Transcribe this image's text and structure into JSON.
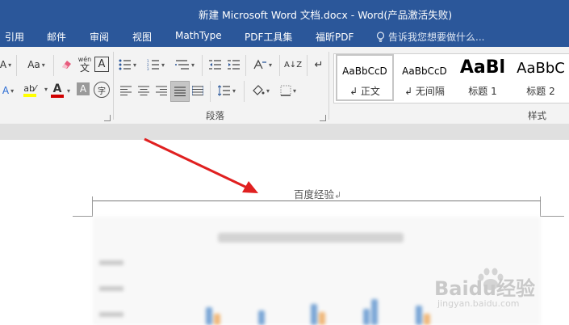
{
  "window": {
    "title": "新建 Microsoft Word 文档.docx - Word(产品激活失败)"
  },
  "menu": {
    "tabs": [
      "引用",
      "邮件",
      "审阅",
      "视图",
      "MathType",
      "PDF工具集",
      "福昕PDF"
    ],
    "tell_me": "告诉我您想要做什么..."
  },
  "ribbon": {
    "font_size_label": "Aa",
    "phonetic_top": "wén",
    "phonetic_char": "文",
    "char_border": "A",
    "font_color": "A",
    "char_shading": "A",
    "enclosed_char": "字",
    "sort_label": "A↓Z",
    "paragraph_group": "段落",
    "styles_group": "样式"
  },
  "styles": [
    {
      "sample": "AaBbCcD",
      "name": "↲ 正文"
    },
    {
      "sample": "AaBbCcD",
      "name": "↲ 无间隔"
    },
    {
      "sample": "AaBl",
      "name": "标题 1"
    },
    {
      "sample": "AaBbC",
      "name": "标题 2"
    }
  ],
  "document": {
    "header_text": "百度经验",
    "paragraph_mark": "↲"
  },
  "watermark": {
    "brand": "Baidu经验",
    "url": "jingyan.baidu.com"
  },
  "colors": {
    "word_blue": "#2b579a",
    "arrow_red": "#e02020",
    "highlight_yellow": "#ffff00",
    "font_red": "#d00000"
  }
}
